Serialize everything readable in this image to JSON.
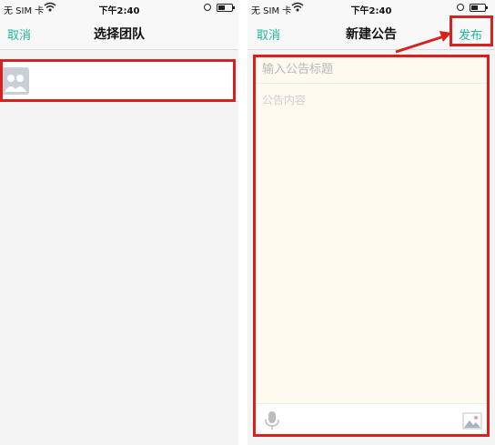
{
  "status_bar": {
    "carrier": "无 SIM 卡",
    "time": "下午2:40",
    "icons": [
      "wifi-icon",
      "orientation-lock-icon",
      "battery-icon"
    ]
  },
  "left_screen": {
    "nav": {
      "cancel": "取消",
      "title": "选择团队"
    },
    "team_item": {
      "icon": "team-avatar-icon",
      "name": ""
    }
  },
  "right_screen": {
    "nav": {
      "cancel": "取消",
      "title": "新建公告",
      "publish": "发布"
    },
    "form": {
      "title_placeholder": "输入公告标题",
      "content_placeholder": "公告内容"
    },
    "toolbar": {
      "icons": [
        "microphone-icon",
        "image-icon"
      ]
    }
  },
  "colors": {
    "accent": "#1bb79b",
    "highlight": "#d8201e",
    "compose_bg": "#fffaf0",
    "page_bg": "#f4f4f4"
  }
}
